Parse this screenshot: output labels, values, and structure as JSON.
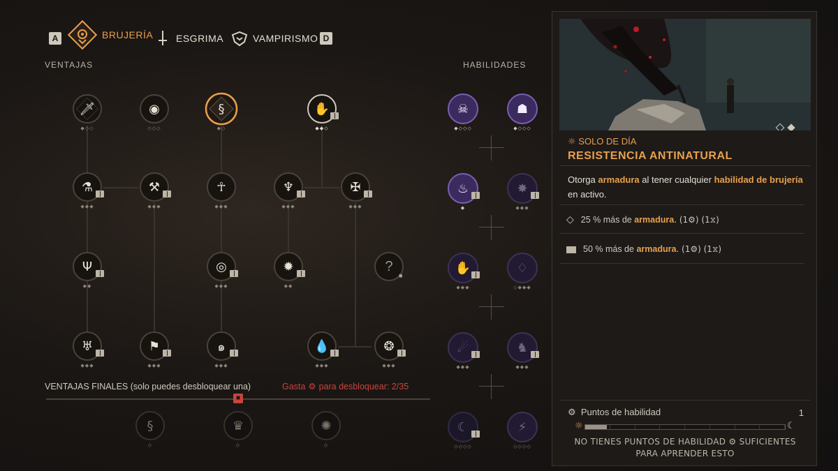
{
  "tabs": {
    "prev_key": "A",
    "next_key": "D",
    "items": [
      {
        "label": "BRUJERÍA",
        "icon": "sorcery-eye-icon",
        "active": true
      },
      {
        "label": "ESGRIMA",
        "icon": "sword-icon",
        "active": false
      },
      {
        "label": "VAMPIRISMO",
        "icon": "vampire-icon",
        "active": false
      }
    ]
  },
  "sections": {
    "perks": "VENTAJAS",
    "skills": "HABILIDADES",
    "final_perks": "VENTAJAS FINALES (solo puedes desbloquear una)",
    "spend_prefix": "Gasta",
    "spend_suffix": "para desbloquear: 2/35"
  },
  "detail": {
    "kicker": "SOLO DE DÍA",
    "title": "RESISTENCIA ANTINATURAL",
    "desc_1": "Otorga ",
    "desc_2": "armadura",
    "desc_3": " al tener cualquier ",
    "desc_4": "habilidad de brujería",
    "desc_5": " en activo.",
    "bonus_1_prefix": "25 % más de ",
    "bonus_1_hl": "armadura",
    "bonus_1_suffix": ".  (1⚙) (1⧖)",
    "bonus_2_prefix": "50 % más de ",
    "bonus_2_hl": "armadura",
    "bonus_2_suffix": ".  (1⚙) (1⧖)",
    "points_label": "Puntos de habilidad",
    "points_value": "1",
    "warn_1": "NO TIENES PUNTOS DE HABILIDAD ⚙ SUFICIENTES",
    "warn_2": "PARA APRENDER ESTO"
  },
  "glyphs": {
    "sun": "☼",
    "moon": "☾",
    "gear": "⚙",
    "hourglass": "⧗",
    "question": "?",
    "lock": "🔒"
  },
  "colors": {
    "accent": "#e8a04e",
    "danger": "#c8443d",
    "skill_purple": "#5a3f8a"
  }
}
